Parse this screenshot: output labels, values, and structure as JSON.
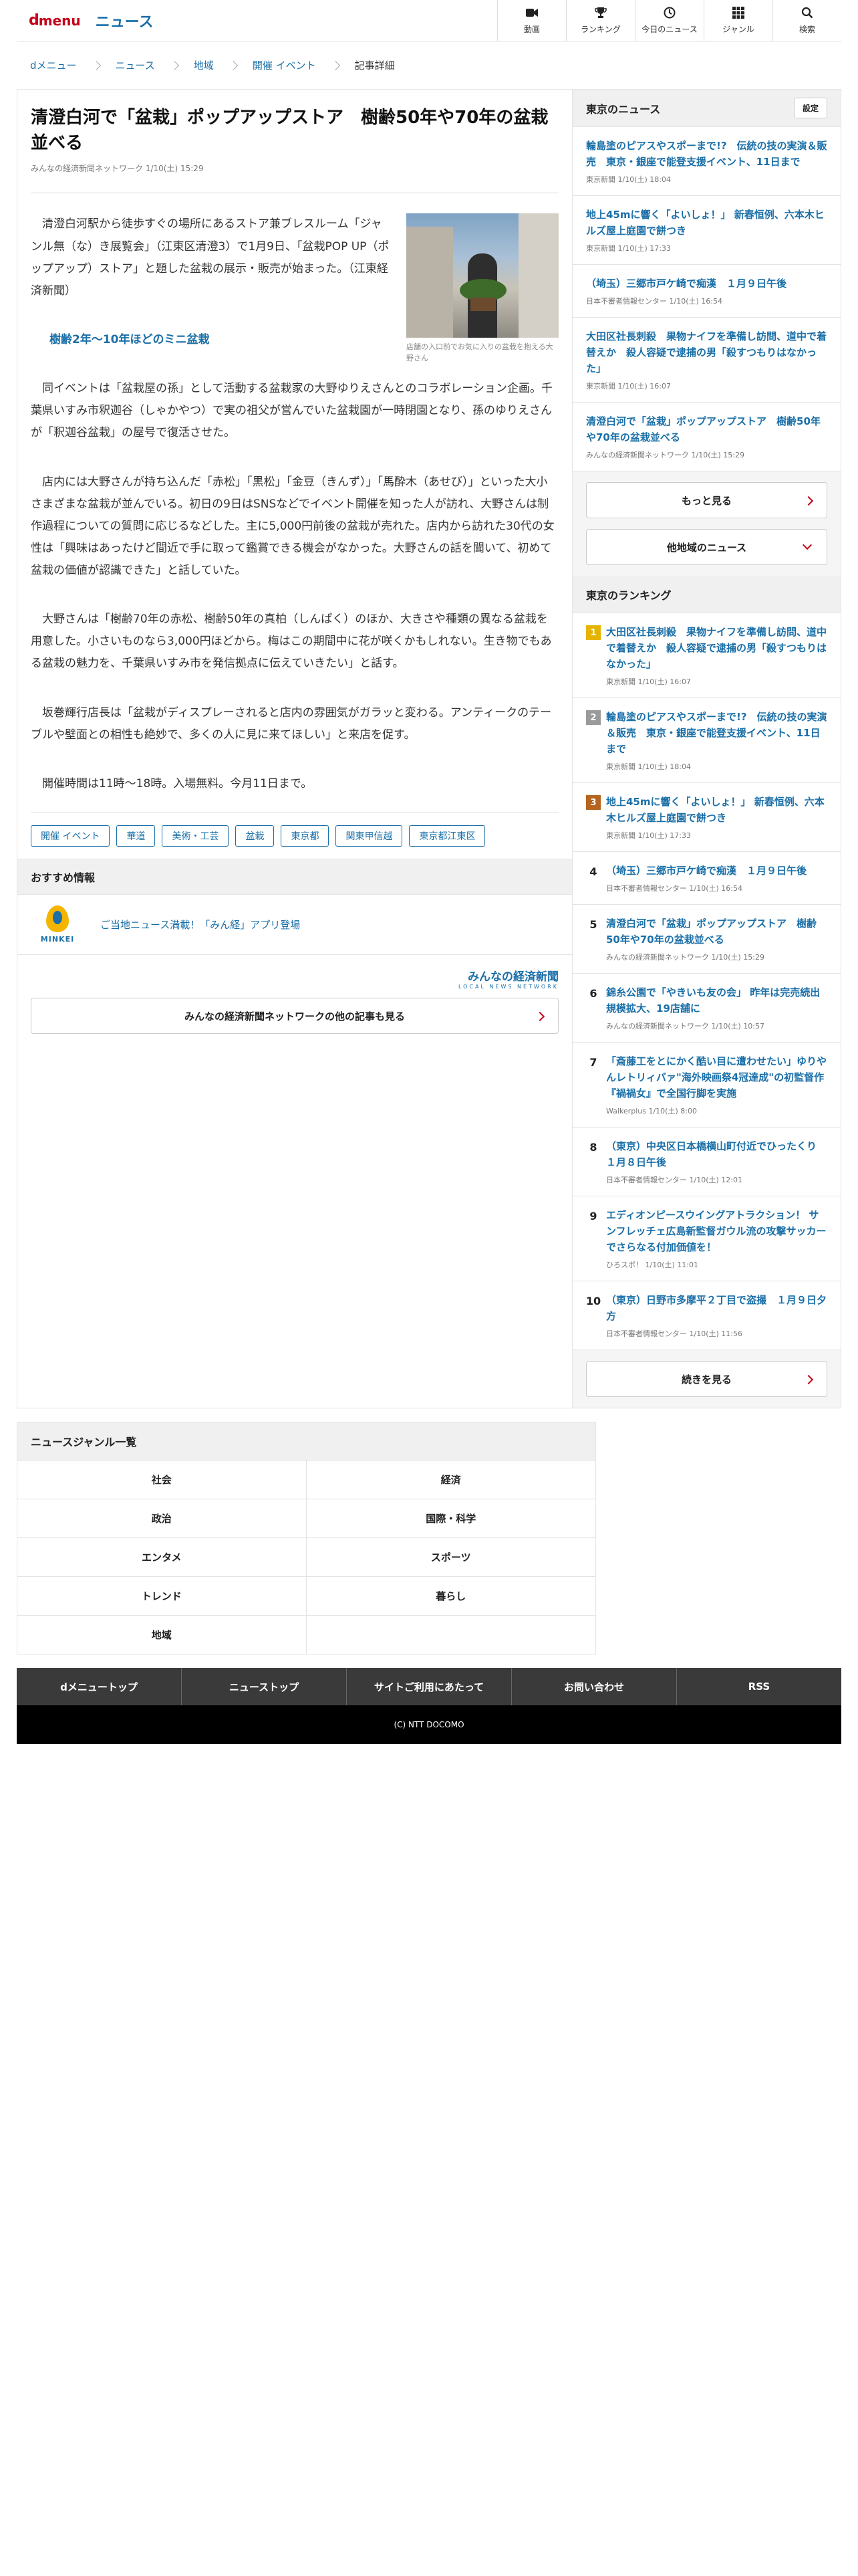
{
  "header": {
    "logo_d": "d",
    "logo_menu": "menu",
    "section": "ニュース",
    "nav": [
      {
        "label": "動画",
        "icon": "video-icon"
      },
      {
        "label": "ランキング",
        "icon": "trophy-icon"
      },
      {
        "label": "今日のニュース",
        "icon": "clock-icon"
      },
      {
        "label": "ジャンル",
        "icon": "grid-icon"
      },
      {
        "label": "検索",
        "icon": "search-icon"
      }
    ]
  },
  "breadcrumb": [
    "dメニュー",
    "ニュース",
    "地域",
    "開催 イベント",
    "記事詳細"
  ],
  "article": {
    "title": "清澄白河で「盆栽」ポップアップストア　樹齢50年や70年の盆栽並べる",
    "meta": "みんなの経済新聞ネットワーク 1/10(土) 15:29",
    "lead": "清澄白河駅から徒歩すぐの場所にあるストア兼ブレスルーム「ジャンル無（な）き展覧会」（江東区清澄3）で1月9日、「盆栽POP UP（ポップアップ）ストア」と題した盆栽の展示・販売が始まった。（江東経済新聞）",
    "photo_caption": "店舗の入口前でお気に入りの盆栽を抱える大野さん",
    "subhead": "樹齢2年～10年ほどのミニ盆栽",
    "paragraphs": [
      "同イベントは「盆栽屋の孫」として活動する盆栽家の大野ゆりえさんとのコラボレーション企画。千葉県いすみ市釈迦谷（しゃかやつ）で実の祖父が営んでいた盆栽園が一時閉園となり、孫のゆりえさんが「釈迦谷盆栽」の屋号で復活させた。",
      "店内には大野さんが持ち込んだ「赤松」「黒松」「金豆（きんず）」「馬酔木（あせび）」といった大小さまざまな盆栽が並んでいる。初日の9日はSNSなどでイベント開催を知った人が訪れ、大野さんは制作過程についての質問に応じるなどした。主に5,000円前後の盆栽が売れた。店内から訪れた30代の女性は「興味はあったけど間近で手に取って鑑賞できる機会がなかった。大野さんの話を聞いて、初めて盆栽の価値が認識できた」と話していた。",
      "大野さんは「樹齢70年の赤松、樹齢50年の真柏（しんぱく）のほか、大きさや種類の異なる盆栽を用意した。小さいものなら3,000円ほどから。梅はこの期間中に花が咲くかもしれない。生き物でもある盆栽の魅力を、千葉県いすみ市を発信拠点に伝えていきたい」と話す。",
      "坂巻輝行店長は「盆栽がディスプレーされると店内の雰囲気がガラッと変わる。アンティークのテーブルや壁面との相性も絶妙で、多くの人に見に来てほしい」と来店を促す。",
      "開催時間は11時～18時。入場無料。今月11日まで。"
    ],
    "tags": [
      "開催 イベント",
      "華道",
      "美術・工芸",
      "盆栽",
      "東京都",
      "関東甲信越",
      "東京都江東区"
    ]
  },
  "recommend": {
    "heading": "おすすめ情報",
    "logo_text": "MINKEI",
    "link": "ご当地ニュース満載！「みん経」アプリ登場",
    "network_logo": "みんなの経済新聞",
    "network_logo_sub": "LOCAL NEWS NETWORK",
    "more_button": "みんなの経済新聞ネットワークの他の記事も見る"
  },
  "side_news": {
    "heading": "東京のニュース",
    "setting": "設定",
    "items": [
      {
        "title": "輪島塗のピアスやスポーまで!?　伝統の技の実演＆販売　東京・銀座で能登支援イベント、11日まで",
        "meta": "東京新聞 1/10(土) 18:04"
      },
      {
        "title": "地上45mに響く「よいしょ！」 新春恒例、六本木ヒルズ屋上庭園で餅つき",
        "meta": "東京新聞 1/10(土) 17:33"
      },
      {
        "title": "（埼玉）三郷市戸ケ崎で痴漢　１月９日午後",
        "meta": "日本不審者情報センター 1/10(土) 16:54"
      },
      {
        "title": "大田区社長刺殺　果物ナイフを準備し訪問、道中で着替えか　殺人容疑で逮捕の男「殺すつもりはなかった」",
        "meta": "東京新聞 1/10(土) 16:07"
      },
      {
        "title": "清澄白河で「盆栽」ポップアップストア　樹齢50年や70年の盆栽並べる",
        "meta": "みんなの経済新聞ネットワーク 1/10(土) 15:29"
      }
    ],
    "more": "もっと見る",
    "other_region": "他地域のニュース"
  },
  "ranking": {
    "heading": "東京のランキング",
    "items": [
      {
        "rank": "1",
        "title": "大田区社長刺殺　果物ナイフを準備し訪問、道中で着替えか　殺人容疑で逮捕の男「殺すつもりはなかった」",
        "meta": "東京新聞 1/10(土) 16:07"
      },
      {
        "rank": "2",
        "title": "輪島塗のピアスやスポーまで!?　伝統の技の実演＆販売　東京・銀座で能登支援イベント、11日まで",
        "meta": "東京新聞 1/10(土) 18:04"
      },
      {
        "rank": "3",
        "title": "地上45mに響く「よいしょ！」 新春恒例、六本木ヒルズ屋上庭園で餅つき",
        "meta": "東京新聞 1/10(土) 17:33"
      },
      {
        "rank": "4",
        "title": "（埼玉）三郷市戸ケ崎で痴漢　１月９日午後",
        "meta": "日本不審者情報センター 1/10(土) 16:54"
      },
      {
        "rank": "5",
        "title": "清澄白河で「盆栽」ポップアップストア　樹齢50年や70年の盆栽並べる",
        "meta": "みんなの経済新聞ネットワーク 1/10(土) 15:29"
      },
      {
        "rank": "6",
        "title": "錦糸公園で「やきいも友の会」 昨年は完売続出　規模拡大、19店舗に",
        "meta": "みんなの経済新聞ネットワーク 1/10(土) 10:57"
      },
      {
        "rank": "7",
        "title": "「斎藤工をとにかく酷い目に遭わせたい」ゆりやんレトリィバァ\"海外映画祭4冠達成\"の初監督作『禍禍女』で全国行脚を実施",
        "meta": "Walkerplus 1/10(土) 8:00"
      },
      {
        "rank": "8",
        "title": "（東京）中央区日本橋横山町付近でひったくり　１月８日午後",
        "meta": "日本不審者情報センター 1/10(土) 12:01"
      },
      {
        "rank": "9",
        "title": "エディオンピースウイングアトラクション！ サンフレッチェ広島新監督ガウル流の攻撃サッカーでさらなる付加価値を！",
        "meta": "ひろスポ！ 1/10(土) 11:01"
      },
      {
        "rank": "10",
        "title": "（東京）日野市多摩平２丁目で盗撮　１月９日夕方",
        "meta": "日本不審者情報センター 1/10(土) 11:56"
      }
    ],
    "more": "続きを見る"
  },
  "genre": {
    "heading": "ニュースジャンル一覧",
    "items": [
      "社会",
      "経済",
      "政治",
      "国際・科学",
      "エンタメ",
      "スポーツ",
      "トレンド",
      "暮らし",
      "地域",
      ""
    ]
  },
  "footer": {
    "links": [
      "dメニュートップ",
      "ニューストップ",
      "サイトご利用にあたって",
      "お問い合わせ",
      "RSS"
    ],
    "copyright": "(C) NTT DOCOMO"
  },
  "colors": {
    "brand_red": "#c4001a",
    "link_blue": "#1a6fa8"
  }
}
